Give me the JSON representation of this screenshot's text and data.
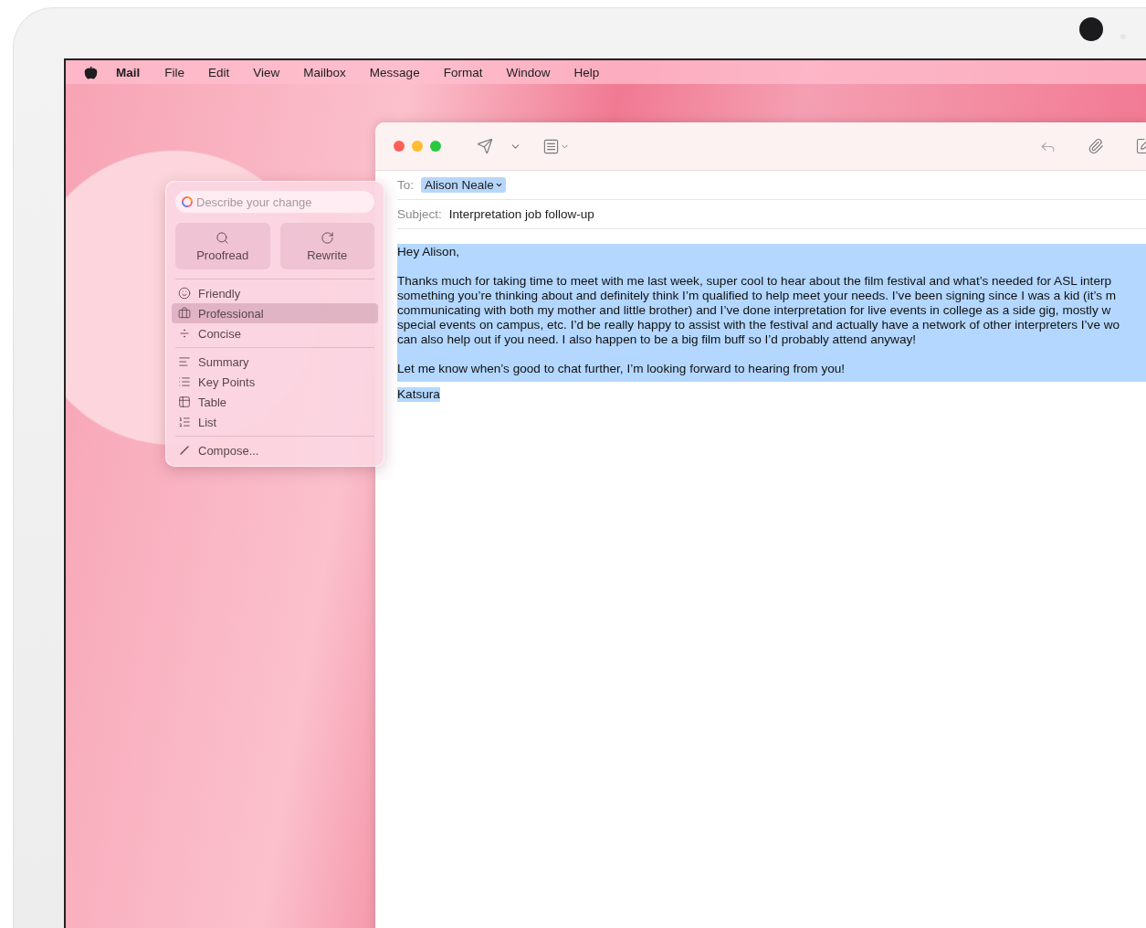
{
  "menu_bar": {
    "app": "Mail",
    "items": [
      "File",
      "Edit",
      "View",
      "Mailbox",
      "Message",
      "Format",
      "Window",
      "Help"
    ]
  },
  "writing_tools": {
    "placeholder": "Describe your change",
    "actions": [
      {
        "label": "Proofread"
      },
      {
        "label": "Rewrite"
      }
    ],
    "groups": [
      [
        {
          "label": "Friendly",
          "selected": false
        },
        {
          "label": "Professional",
          "selected": true
        },
        {
          "label": "Concise",
          "selected": false
        }
      ],
      [
        {
          "label": "Summary",
          "selected": false
        },
        {
          "label": "Key Points",
          "selected": false
        },
        {
          "label": "Table",
          "selected": false
        },
        {
          "label": "List",
          "selected": false
        }
      ],
      [
        {
          "label": "Compose...",
          "selected": false
        }
      ]
    ]
  },
  "mail": {
    "to": {
      "label": "To:",
      "recipient": "Alison Neale"
    },
    "subject": {
      "label": "Subject:",
      "value": "Interpretation job follow-up"
    },
    "body": {
      "selected": true,
      "greeting": "Hey Alison,",
      "paragraphs": [
        [
          "Thanks much for taking time to meet with me last week, super cool to hear about the film festival and what’s needed for ASL interp",
          "something you’re thinking about and definitely think I’m qualified to help meet your needs. I’ve been signing since I was a kid (it’s m",
          "communicating with both my mother and little brother) and I’ve done interpretation for  live events in college as a side gig, mostly w",
          "special events on campus, etc. I’d be really happy to assist with the festival and actually have a network of other interpreters I’ve wo",
          "can also help out if you need. I also happen to be a big film buff so I’d probably attend anyway!"
        ],
        [
          "Let me know when’s good to chat further, I’m looking forward to hearing from you!"
        ]
      ],
      "signature": "Katsura"
    }
  }
}
